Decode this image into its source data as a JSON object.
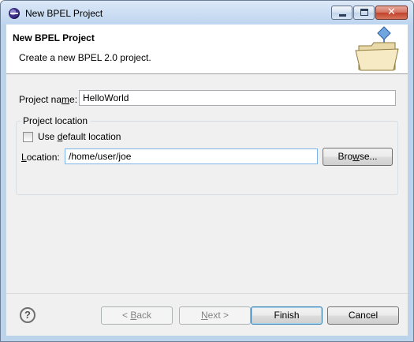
{
  "window": {
    "title": "New BPEL Project",
    "icon": "eclipse-icon",
    "controls": {
      "minimize": "minimize-icon",
      "maximize": "maximize-icon",
      "close_glyph": "✕"
    }
  },
  "banner": {
    "title": "New BPEL Project",
    "description": "Create a new BPEL 2.0 project.",
    "graphic": "folder-wizard-icon"
  },
  "form": {
    "project_name_label_pre": "Project na",
    "project_name_label_mn": "m",
    "project_name_label_post": "e:",
    "project_name_value": "HelloWorld",
    "location_group_title": "Project location",
    "use_default_pre": "Use ",
    "use_default_mn": "d",
    "use_default_post": "efault location",
    "use_default_checked": false,
    "location_label_mn": "L",
    "location_label_post": "ocation:",
    "location_value": "/home/user/joe",
    "browse_pre": "Bro",
    "browse_mn": "w",
    "browse_post": "se..."
  },
  "footer": {
    "help_glyph": "?",
    "back_pre": "< ",
    "back_mn": "B",
    "back_post": "ack",
    "next_mn": "N",
    "next_post": "ext >",
    "finish": "Finish",
    "cancel": "Cancel"
  },
  "colors": {
    "title_bar": "#bed5ef",
    "dialog_bg": "#f0f0f0",
    "focus_border": "#7eb4ea"
  }
}
